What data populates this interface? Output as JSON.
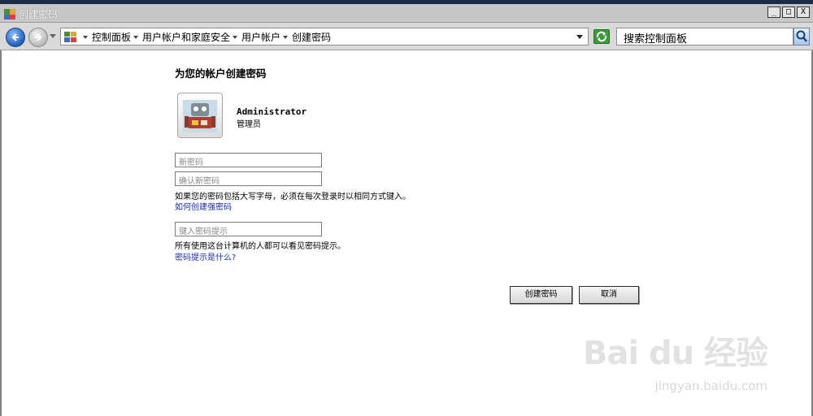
{
  "window": {
    "title": "创建密码",
    "min": "_",
    "max": "□",
    "close": "X"
  },
  "nav": {
    "breadcrumbs": [
      {
        "label": "控制面板"
      },
      {
        "label": "用户帐户和家庭安全"
      },
      {
        "label": "用户帐户"
      },
      {
        "label": "创建密码"
      }
    ],
    "search_placeholder": "搜索控制面板"
  },
  "main": {
    "heading": "为您的帐户创建密码",
    "user": {
      "name": "Administrator",
      "role": "管理员"
    },
    "new_password_placeholder": "新密码",
    "confirm_password_placeholder": "确认新密码",
    "case_note": "如果您的密码包括大写字母，必须在每次登录时以相同方式键入。",
    "strong_password_link": "如何创建强密码",
    "hint_placeholder": "键入密码提示",
    "hint_note": "所有使用这台计算机的人都可以看见密码提示。",
    "hint_link": "密码提示是什么?",
    "create_button": "创建密码",
    "cancel_button": "取消"
  },
  "watermark": {
    "logo": "Bai du 经验",
    "url": "jingyan.baidu.com"
  }
}
